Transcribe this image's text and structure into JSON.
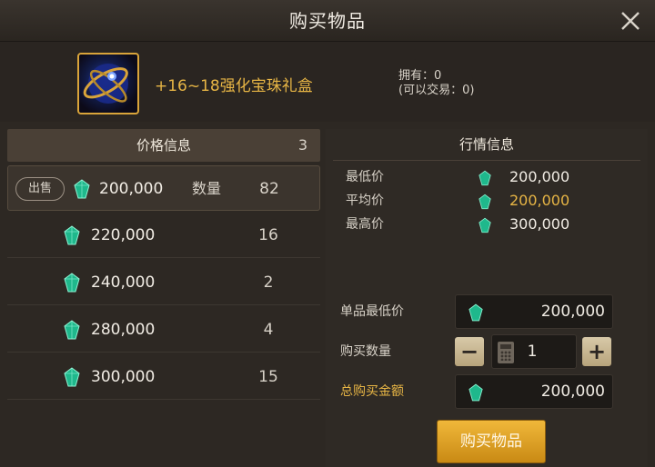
{
  "window": {
    "title": "购买物品"
  },
  "item": {
    "name": "+16~18强化宝珠礼盒",
    "owned_line": "拥有：0",
    "tradable_line": "(可以交易：0)"
  },
  "price_list": {
    "header": "价格信息",
    "count": "3",
    "sell_badge": "出售",
    "qty_label": "数量",
    "rows": [
      {
        "price": "200,000",
        "qty": "82"
      },
      {
        "price": "220,000",
        "qty": "16"
      },
      {
        "price": "240,000",
        "qty": "2"
      },
      {
        "price": "280,000",
        "qty": "4"
      },
      {
        "price": "300,000",
        "qty": "15"
      }
    ]
  },
  "market": {
    "header": "行情信息",
    "stats": [
      {
        "label": "最低价",
        "value": "200,000"
      },
      {
        "label": "平均价",
        "value": "200,000"
      },
      {
        "label": "最高价",
        "value": "300,000"
      }
    ]
  },
  "purchase": {
    "unit_min_label": "单品最低价",
    "unit_min_value": "200,000",
    "qty_label": "购买数量",
    "qty_value": "1",
    "minus": "−",
    "plus": "+",
    "total_label": "总购买金额",
    "total_value": "200,000",
    "buy_button": "购买物品"
  },
  "colors": {
    "accent_gold": "#e7b545",
    "gem": "#2fd3a3"
  }
}
